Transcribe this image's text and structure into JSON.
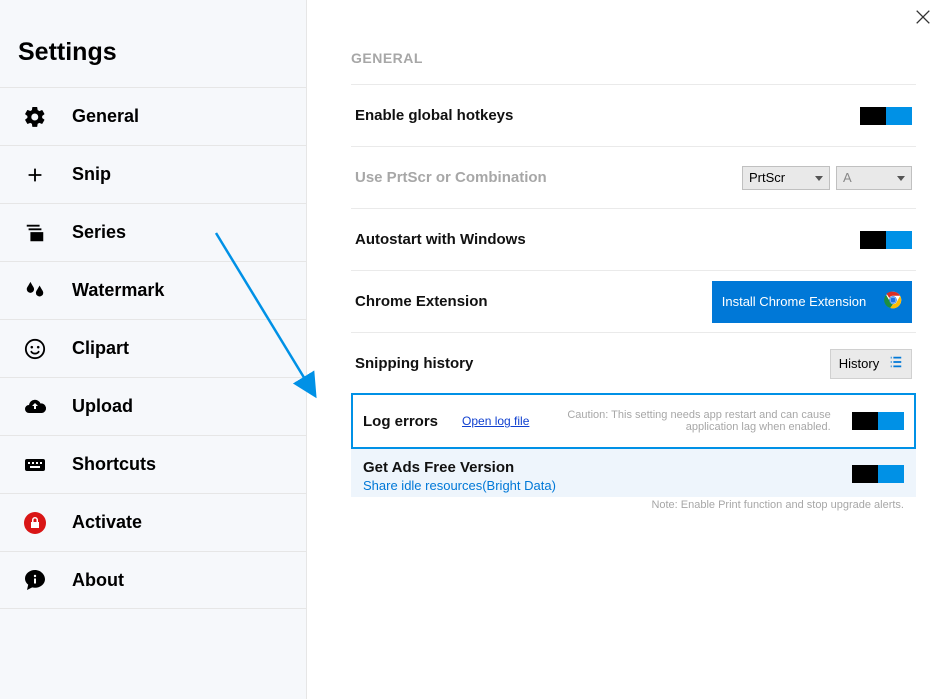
{
  "sidebar": {
    "title": "Settings",
    "items": [
      {
        "label": "General",
        "icon": "gear-icon"
      },
      {
        "label": "Snip",
        "icon": "plus-icon"
      },
      {
        "label": "Series",
        "icon": "stack-icon"
      },
      {
        "label": "Watermark",
        "icon": "drops-icon"
      },
      {
        "label": "Clipart",
        "icon": "smile-icon"
      },
      {
        "label": "Upload",
        "icon": "cloud-icon"
      },
      {
        "label": "Shortcuts",
        "icon": "keyboard-icon"
      },
      {
        "label": "Activate",
        "icon": "lock-icon"
      },
      {
        "label": "About",
        "icon": "chat-icon"
      }
    ]
  },
  "main": {
    "section_header": "GENERAL",
    "settings": {
      "hotkeys": {
        "label": "Enable global hotkeys"
      },
      "prtscr": {
        "label": "Use PrtScr or Combination",
        "select1": "PrtScr",
        "select2": "A"
      },
      "autostart": {
        "label": "Autostart with Windows"
      },
      "chrome": {
        "label": "Chrome Extension",
        "button": "Install Chrome Extension"
      },
      "history": {
        "label": "Snipping history",
        "button": "History"
      },
      "log": {
        "label": "Log errors",
        "link": "Open log file",
        "caution": "Caution: This setting needs app restart and can cause application lag when enabled."
      },
      "ads": {
        "label": "Get Ads Free Version",
        "sublabel": "Share idle resources(Bright Data)",
        "note": "Note: Enable Print function and stop upgrade alerts."
      }
    }
  }
}
